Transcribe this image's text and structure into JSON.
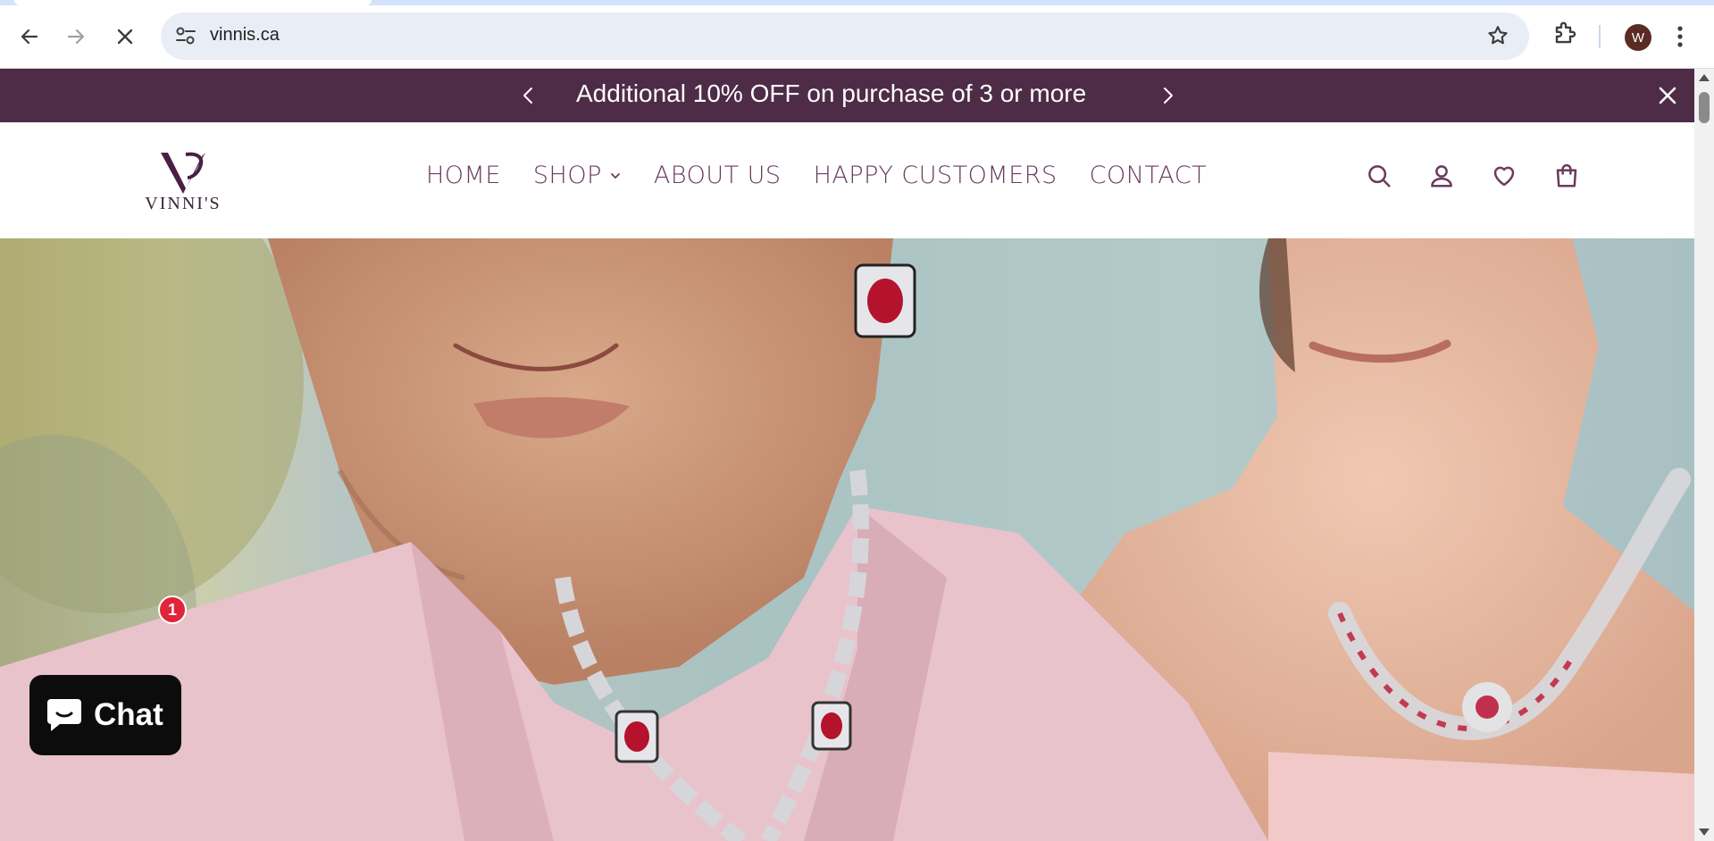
{
  "browser": {
    "url": "vinnis.ca",
    "profile_initial": "W"
  },
  "announcement": {
    "text": "Additional 10% OFF on purchase of 3 or more"
  },
  "logo": {
    "brand": "VINNI'S"
  },
  "nav": {
    "items": [
      {
        "label": "HOME"
      },
      {
        "label": "SHOP"
      },
      {
        "label": "ABOUT US"
      },
      {
        "label": "HAPPY CUSTOMERS"
      },
      {
        "label": "CONTACT"
      }
    ]
  },
  "chat": {
    "label": "Chat",
    "badge": "1"
  },
  "colors": {
    "announcement_bg": "#4e2c47",
    "nav_text": "#6b3a5e",
    "chat_bg": "#0c0c0c",
    "badge": "#e0243a"
  }
}
